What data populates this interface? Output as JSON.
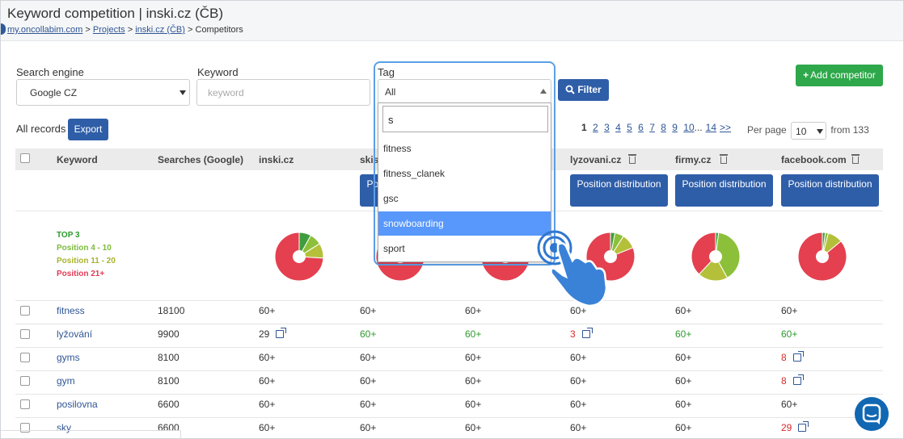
{
  "header": {
    "title": "Keyword competition | inski.cz (ČB)",
    "breadcrumb": [
      {
        "label": "my.oncollabim.com",
        "link": true
      },
      {
        "label": "Projects",
        "link": true
      },
      {
        "label": "inski.cz (ČB)",
        "link": true
      },
      {
        "label": "Competitors",
        "link": false
      }
    ],
    "sep": ">"
  },
  "filters": {
    "search_engine_label": "Search engine",
    "search_engine_value": "Google CZ",
    "keyword_label": "Keyword",
    "keyword_placeholder": "keyword",
    "tag_label": "Tag",
    "tag_value": "All",
    "filter_button": "Filter",
    "add_competitor_button": "Add competitor"
  },
  "records": {
    "label": "All records",
    "export_button": "Export"
  },
  "pagination": {
    "current": "1",
    "pages": [
      "2",
      "3",
      "4",
      "5",
      "6",
      "7",
      "8",
      "9",
      "10"
    ],
    "ellipsis": "...",
    "last": "14",
    "next": ">>",
    "per_page_label": "Per page",
    "per_page_value": "10",
    "total_label": "from 133"
  },
  "table": {
    "headers": {
      "keyword": "Keyword",
      "searches": "Searches (Google)",
      "col1": "inski.cz",
      "col2": "skis",
      "col4": "lyzovani.cz",
      "col5": "firmy.cz",
      "col6": "facebook.com"
    },
    "position_button": "Position distribution",
    "legend": [
      {
        "label": "TOP 3",
        "color": "#2e9a2e"
      },
      {
        "label": "Position 4 - 10",
        "color": "#7cbb3b"
      },
      {
        "label": "Position 11 - 20",
        "color": "#a8b32f"
      },
      {
        "label": "Position 21+",
        "color": "#e23b55"
      }
    ],
    "pie_colors": {
      "top3": "#3e9e3e",
      "p4_10": "#8dc03a",
      "p11_20": "#b5c03a",
      "p21": "#e4404f"
    },
    "pies": [
      {
        "col": "inski.cz",
        "top3": 8,
        "p4_10": 8,
        "p11_20": 10,
        "p21": 74
      },
      {
        "col": "lyzovani.cz",
        "top3": 3,
        "p4_10": 6,
        "p11_20": 10,
        "p21": 81
      },
      {
        "col": "firmy.cz",
        "top3": 2,
        "p4_10": 40,
        "p11_20": 20,
        "p21": 38
      },
      {
        "col": "facebook.com",
        "top3": 2,
        "p4_10": 2,
        "p11_20": 10,
        "p21": 86
      }
    ],
    "rows": [
      {
        "keyword": "fitness",
        "searches": "18100",
        "c1": "60+",
        "c2": "60+",
        "c3": "60+",
        "c4": "60+",
        "c5": "60+",
        "c6": "60+"
      },
      {
        "keyword": "lyžování",
        "searches": "9900",
        "c1": "29",
        "c2": "60+",
        "c3": "60+",
        "c4": "3",
        "c5": "60+",
        "c6": "60+"
      },
      {
        "keyword": "gyms",
        "searches": "8100",
        "c1": "60+",
        "c2": "60+",
        "c3": "60+",
        "c4": "60+",
        "c5": "60+",
        "c6": "8"
      },
      {
        "keyword": "gym",
        "searches": "8100",
        "c1": "60+",
        "c2": "60+",
        "c3": "60+",
        "c4": "60+",
        "c5": "60+",
        "c6": "8"
      },
      {
        "keyword": "posilovna",
        "searches": "6600",
        "c1": "60+",
        "c2": "60+",
        "c3": "60+",
        "c4": "60+",
        "c5": "60+",
        "c6": "60+"
      },
      {
        "keyword": "sky",
        "searches": "6600",
        "c1": "60+",
        "c2": "60+",
        "c3": "60+",
        "c4": "60+",
        "c5": "60+",
        "c6": "29"
      }
    ]
  },
  "tag_dropdown": {
    "search_value": "s",
    "options": [
      "fitness",
      "fitness_clanek",
      "gsc",
      "snowboarding",
      "sport"
    ],
    "highlighted": "snowboarding"
  }
}
